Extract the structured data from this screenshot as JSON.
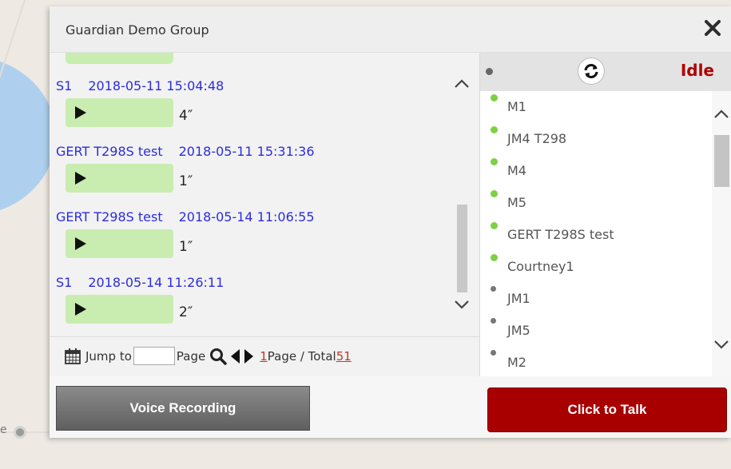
{
  "map": {
    "partial_label": "e"
  },
  "dialog": {
    "title": "Guardian Demo Group",
    "close_icon": "close-icon"
  },
  "messages": [
    {
      "sender": "S1",
      "timestamp": "2018-05-11 15:04:48",
      "duration": "4″"
    },
    {
      "sender": "GERT T298S test",
      "timestamp": "2018-05-11 15:31:36",
      "duration": "1″"
    },
    {
      "sender": "GERT T298S test",
      "timestamp": "2018-05-14 11:06:55",
      "duration": "1″"
    },
    {
      "sender": "S1",
      "timestamp": "2018-05-14 11:26:11",
      "duration": "2″"
    }
  ],
  "pager": {
    "jump_label": "Jump to",
    "page_input_value": "",
    "page_label": "Page",
    "current_page": "1",
    "page_separator": "Page / Total",
    "total": "51",
    "icons": [
      "calendar-icon",
      "search-icon",
      "prev-page-icon",
      "next-page-icon"
    ]
  },
  "members_header": {
    "status": "Idle",
    "refresh_icon": "refresh-icon"
  },
  "members": [
    {
      "name": "M1",
      "online": true
    },
    {
      "name": "JM4 T298",
      "online": true
    },
    {
      "name": "M4",
      "online": true
    },
    {
      "name": "M5",
      "online": true
    },
    {
      "name": "GERT T298S test",
      "online": true
    },
    {
      "name": "Courtney1",
      "online": true
    },
    {
      "name": "JM1",
      "online": false
    },
    {
      "name": "JM5",
      "online": false
    },
    {
      "name": "M2",
      "online": false
    }
  ],
  "buttons": {
    "record_label": "Voice Recording",
    "talk_label": "Click to Talk"
  },
  "colors": {
    "online": "#7ed043",
    "offline": "#777777",
    "talk_button": "#a80000",
    "status_idle": "#b00000",
    "message_header": "#2c2ce0",
    "bubble": "#c9ecb0"
  }
}
